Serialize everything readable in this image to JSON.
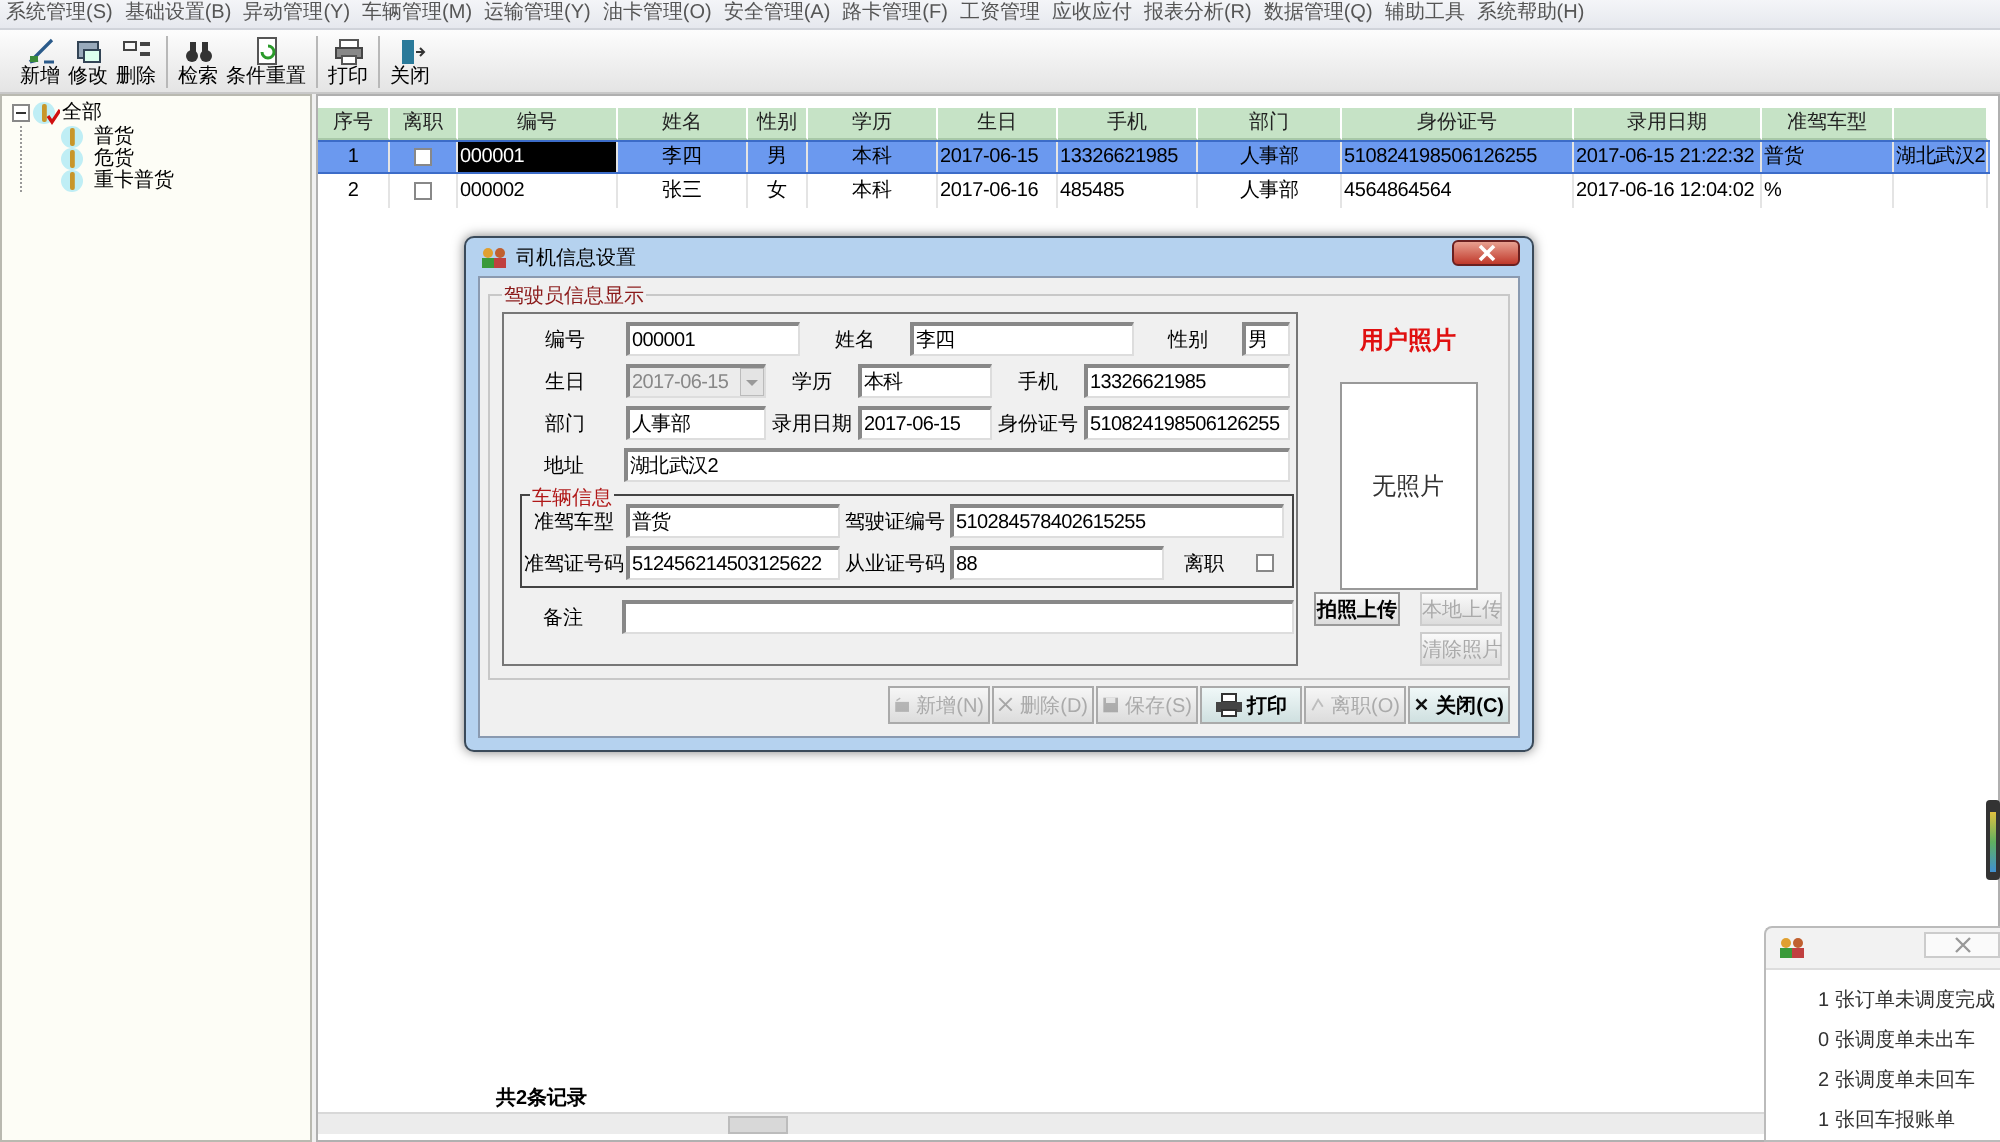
{
  "menu": [
    "系统管理(S)",
    "基础设置(B)",
    "异动管理(Y)",
    "车辆管理(M)",
    "运输管理(Y)",
    "油卡管理(O)",
    "安全管理(A)",
    "路卡管理(F)",
    "工资管理",
    "应收应付",
    "报表分析(R)",
    "数据管理(Q)",
    "辅助工具",
    "系统帮助(H)"
  ],
  "toolbar": [
    [
      "新增",
      "修改",
      "删除"
    ],
    [
      "检索",
      "条件重置"
    ],
    [
      "打印"
    ],
    [
      "关闭"
    ]
  ],
  "tree": {
    "label": "全部",
    "expanded": true,
    "children": [
      {
        "label": "普货"
      },
      {
        "label": "危货"
      },
      {
        "label": "重卡普货"
      }
    ]
  },
  "grid": {
    "columns": [
      "序号",
      "离职",
      "编号",
      "姓名",
      "性别",
      "学历",
      "生日",
      "手机",
      "部门",
      "身份证号",
      "录用日期",
      "准驾车型"
    ],
    "rows": [
      {
        "selected": true,
        "focused": true,
        "cells": [
          "1",
          {
            "checked": false
          },
          "000001",
          "李四",
          "男",
          "本科",
          "2017-06-15",
          "13326621985",
          "人事部",
          "510824198506126255",
          "2017-06-15 21:22:32",
          "普货",
          "湖北武汉2"
        ]
      },
      {
        "selected": false,
        "focused": false,
        "cells": [
          "2",
          {
            "checked": false
          },
          "000002",
          "张三",
          "女",
          "本科",
          "2017-06-16",
          "485485",
          "人事部",
          "4564864564",
          "2017-06-16 12:04:02",
          "%"
        ]
      }
    ],
    "footer": "共2条记录"
  },
  "dialog": {
    "title": "司机信息设置",
    "driver_group": {
      "title": "驾驶员信息显示",
      "rows": [
        [
          {
            "label": "编号",
            "value": "000001",
            "kind": "text"
          },
          {
            "label": "姓名",
            "value": "李四",
            "kind": "text"
          },
          {
            "label": "性别",
            "value": "男",
            "kind": "text"
          }
        ],
        [
          {
            "label": "生日",
            "value": "2017-06-15",
            "kind": "date",
            "disabled": true
          },
          {
            "label": "学历",
            "value": "本科",
            "kind": "text"
          },
          {
            "label": "手机",
            "value": "13326621985",
            "kind": "text"
          }
        ],
        [
          {
            "label": "部门",
            "value": "人事部",
            "kind": "text"
          },
          {
            "label": "录用日期",
            "value": "2017-06-15",
            "kind": "text"
          },
          {
            "label": "身份证号",
            "value": "510824198506126255",
            "kind": "text"
          }
        ],
        [
          {
            "label": "地址",
            "value": "湖北武汉2",
            "kind": "text"
          }
        ]
      ]
    },
    "vehicle_group": {
      "title": "车辆信息",
      "rows": [
        [
          {
            "label": "准驾车型",
            "value": "普货",
            "kind": "text"
          },
          {
            "label": "驾驶证编号",
            "value": "510284578402615255",
            "kind": "text"
          }
        ],
        [
          {
            "label": "准驾证号码",
            "value": "512456214503125622",
            "kind": "text"
          },
          {
            "label": "从业证号码",
            "value": "88",
            "kind": "text"
          },
          {
            "label": "离职",
            "checked": false,
            "kind": "checkbox"
          }
        ]
      ]
    },
    "remark": {
      "label": "备注"
    },
    "photo": {
      "title": "用户照片",
      "empty_text": "无照片"
    },
    "photo_buttons": [
      {
        "label": "拍照上传",
        "disabled": false
      },
      {
        "label": "本地上传",
        "disabled": true
      },
      {
        "label": "清除照片",
        "disabled": true
      }
    ],
    "buttons": [
      {
        "label": "新增(N)",
        "disabled": true
      },
      {
        "label": "删除(D)",
        "disabled": true
      },
      {
        "label": "保存(S)",
        "disabled": true
      },
      {
        "label": "打印",
        "disabled": false
      },
      {
        "label": "离职(O)",
        "disabled": true
      },
      {
        "label": "关闭(C)",
        "disabled": false
      }
    ]
  },
  "notice": {
    "lines": [
      "1 张订单未调度完成",
      "0 张调度单未出车",
      "2 张调度单未回车",
      "1 张回车报账单"
    ]
  }
}
